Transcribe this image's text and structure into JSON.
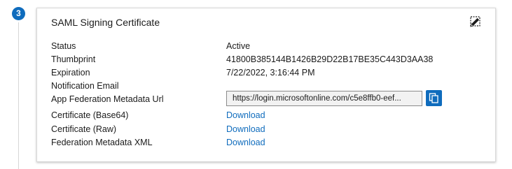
{
  "step": {
    "number": "3"
  },
  "card": {
    "title": "SAML Signing Certificate",
    "edit_icon": "pencil-icon",
    "rows": [
      {
        "label": "Status",
        "value": "Active"
      },
      {
        "label": "Thumbprint",
        "value": "41800B385144B1426B29D22B17BE35C443D3AA38"
      },
      {
        "label": "Expiration",
        "value": "7/22/2022, 3:16:44 PM"
      },
      {
        "label": "Notification Email",
        "value": ""
      },
      {
        "label": "App Federation Metadata Url",
        "value": "https://login.microsoftonline.com/c5e8ffb0-eef..."
      },
      {
        "label": "Certificate (Base64)",
        "link": "Download"
      },
      {
        "label": "Certificate (Raw)",
        "link": "Download"
      },
      {
        "label": "Federation Metadata XML",
        "link": "Download"
      }
    ],
    "copy_icon": "copy-icon"
  },
  "colors": {
    "accent": "#0f6cbd",
    "text": "#1b1b1b",
    "border": "#d9d9d9"
  }
}
